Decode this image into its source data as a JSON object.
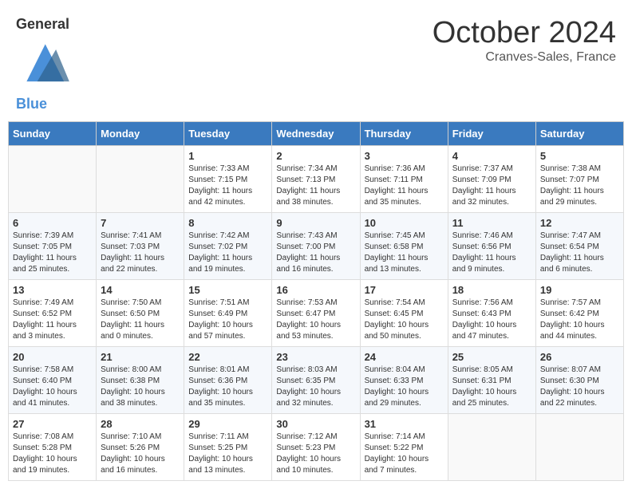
{
  "header": {
    "logo_general": "General",
    "logo_blue": "Blue",
    "month": "October 2024",
    "location": "Cranves-Sales, France"
  },
  "days_of_week": [
    "Sunday",
    "Monday",
    "Tuesday",
    "Wednesday",
    "Thursday",
    "Friday",
    "Saturday"
  ],
  "weeks": [
    [
      {
        "day": "",
        "sunrise": "",
        "sunset": "",
        "daylight": ""
      },
      {
        "day": "",
        "sunrise": "",
        "sunset": "",
        "daylight": ""
      },
      {
        "day": "1",
        "sunrise": "Sunrise: 7:33 AM",
        "sunset": "Sunset: 7:15 PM",
        "daylight": "Daylight: 11 hours and 42 minutes."
      },
      {
        "day": "2",
        "sunrise": "Sunrise: 7:34 AM",
        "sunset": "Sunset: 7:13 PM",
        "daylight": "Daylight: 11 hours and 38 minutes."
      },
      {
        "day": "3",
        "sunrise": "Sunrise: 7:36 AM",
        "sunset": "Sunset: 7:11 PM",
        "daylight": "Daylight: 11 hours and 35 minutes."
      },
      {
        "day": "4",
        "sunrise": "Sunrise: 7:37 AM",
        "sunset": "Sunset: 7:09 PM",
        "daylight": "Daylight: 11 hours and 32 minutes."
      },
      {
        "day": "5",
        "sunrise": "Sunrise: 7:38 AM",
        "sunset": "Sunset: 7:07 PM",
        "daylight": "Daylight: 11 hours and 29 minutes."
      }
    ],
    [
      {
        "day": "6",
        "sunrise": "Sunrise: 7:39 AM",
        "sunset": "Sunset: 7:05 PM",
        "daylight": "Daylight: 11 hours and 25 minutes."
      },
      {
        "day": "7",
        "sunrise": "Sunrise: 7:41 AM",
        "sunset": "Sunset: 7:03 PM",
        "daylight": "Daylight: 11 hours and 22 minutes."
      },
      {
        "day": "8",
        "sunrise": "Sunrise: 7:42 AM",
        "sunset": "Sunset: 7:02 PM",
        "daylight": "Daylight: 11 hours and 19 minutes."
      },
      {
        "day": "9",
        "sunrise": "Sunrise: 7:43 AM",
        "sunset": "Sunset: 7:00 PM",
        "daylight": "Daylight: 11 hours and 16 minutes."
      },
      {
        "day": "10",
        "sunrise": "Sunrise: 7:45 AM",
        "sunset": "Sunset: 6:58 PM",
        "daylight": "Daylight: 11 hours and 13 minutes."
      },
      {
        "day": "11",
        "sunrise": "Sunrise: 7:46 AM",
        "sunset": "Sunset: 6:56 PM",
        "daylight": "Daylight: 11 hours and 9 minutes."
      },
      {
        "day": "12",
        "sunrise": "Sunrise: 7:47 AM",
        "sunset": "Sunset: 6:54 PM",
        "daylight": "Daylight: 11 hours and 6 minutes."
      }
    ],
    [
      {
        "day": "13",
        "sunrise": "Sunrise: 7:49 AM",
        "sunset": "Sunset: 6:52 PM",
        "daylight": "Daylight: 11 hours and 3 minutes."
      },
      {
        "day": "14",
        "sunrise": "Sunrise: 7:50 AM",
        "sunset": "Sunset: 6:50 PM",
        "daylight": "Daylight: 11 hours and 0 minutes."
      },
      {
        "day": "15",
        "sunrise": "Sunrise: 7:51 AM",
        "sunset": "Sunset: 6:49 PM",
        "daylight": "Daylight: 10 hours and 57 minutes."
      },
      {
        "day": "16",
        "sunrise": "Sunrise: 7:53 AM",
        "sunset": "Sunset: 6:47 PM",
        "daylight": "Daylight: 10 hours and 53 minutes."
      },
      {
        "day": "17",
        "sunrise": "Sunrise: 7:54 AM",
        "sunset": "Sunset: 6:45 PM",
        "daylight": "Daylight: 10 hours and 50 minutes."
      },
      {
        "day": "18",
        "sunrise": "Sunrise: 7:56 AM",
        "sunset": "Sunset: 6:43 PM",
        "daylight": "Daylight: 10 hours and 47 minutes."
      },
      {
        "day": "19",
        "sunrise": "Sunrise: 7:57 AM",
        "sunset": "Sunset: 6:42 PM",
        "daylight": "Daylight: 10 hours and 44 minutes."
      }
    ],
    [
      {
        "day": "20",
        "sunrise": "Sunrise: 7:58 AM",
        "sunset": "Sunset: 6:40 PM",
        "daylight": "Daylight: 10 hours and 41 minutes."
      },
      {
        "day": "21",
        "sunrise": "Sunrise: 8:00 AM",
        "sunset": "Sunset: 6:38 PM",
        "daylight": "Daylight: 10 hours and 38 minutes."
      },
      {
        "day": "22",
        "sunrise": "Sunrise: 8:01 AM",
        "sunset": "Sunset: 6:36 PM",
        "daylight": "Daylight: 10 hours and 35 minutes."
      },
      {
        "day": "23",
        "sunrise": "Sunrise: 8:03 AM",
        "sunset": "Sunset: 6:35 PM",
        "daylight": "Daylight: 10 hours and 32 minutes."
      },
      {
        "day": "24",
        "sunrise": "Sunrise: 8:04 AM",
        "sunset": "Sunset: 6:33 PM",
        "daylight": "Daylight: 10 hours and 29 minutes."
      },
      {
        "day": "25",
        "sunrise": "Sunrise: 8:05 AM",
        "sunset": "Sunset: 6:31 PM",
        "daylight": "Daylight: 10 hours and 25 minutes."
      },
      {
        "day": "26",
        "sunrise": "Sunrise: 8:07 AM",
        "sunset": "Sunset: 6:30 PM",
        "daylight": "Daylight: 10 hours and 22 minutes."
      }
    ],
    [
      {
        "day": "27",
        "sunrise": "Sunrise: 7:08 AM",
        "sunset": "Sunset: 5:28 PM",
        "daylight": "Daylight: 10 hours and 19 minutes."
      },
      {
        "day": "28",
        "sunrise": "Sunrise: 7:10 AM",
        "sunset": "Sunset: 5:26 PM",
        "daylight": "Daylight: 10 hours and 16 minutes."
      },
      {
        "day": "29",
        "sunrise": "Sunrise: 7:11 AM",
        "sunset": "Sunset: 5:25 PM",
        "daylight": "Daylight: 10 hours and 13 minutes."
      },
      {
        "day": "30",
        "sunrise": "Sunrise: 7:12 AM",
        "sunset": "Sunset: 5:23 PM",
        "daylight": "Daylight: 10 hours and 10 minutes."
      },
      {
        "day": "31",
        "sunrise": "Sunrise: 7:14 AM",
        "sunset": "Sunset: 5:22 PM",
        "daylight": "Daylight: 10 hours and 7 minutes."
      },
      {
        "day": "",
        "sunrise": "",
        "sunset": "",
        "daylight": ""
      },
      {
        "day": "",
        "sunrise": "",
        "sunset": "",
        "daylight": ""
      }
    ]
  ]
}
